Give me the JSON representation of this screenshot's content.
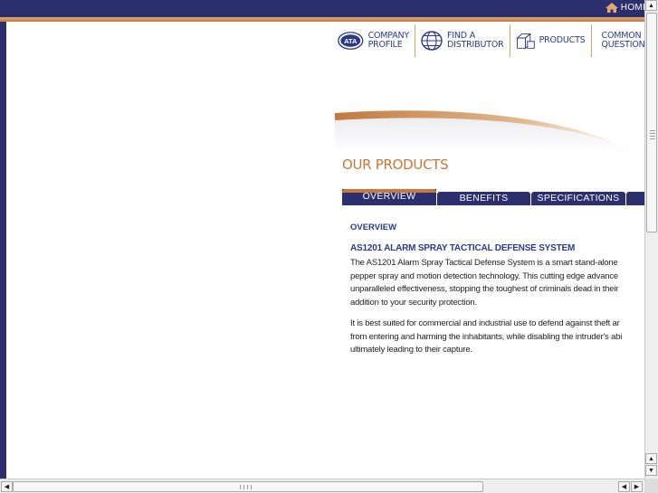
{
  "header": {
    "home_label": "HOME"
  },
  "nav": {
    "company_profile": [
      "COMPANY",
      "PROFILE"
    ],
    "find_distributor": [
      "FIND A",
      "DISTRIBUTOR"
    ],
    "products": "PRODUCTS",
    "questions": [
      "COMMON",
      "QUESTIONS"
    ]
  },
  "section_title": "OUR PRODUCTS",
  "tabs": [
    "OVERVIEW",
    "BENEFITS",
    "SPECIFICATIONS",
    ""
  ],
  "content": {
    "heading": "OVERVIEW",
    "product_title": "AS1201 ALARM SPRAY TACTICAL DEFENSE SYSTEM",
    "paragraph1": [
      "The AS1201 Alarm Spray Tactical Defense System is a smart stand-alone",
      "pepper spray and motion detection technology. This cutting edge advance",
      "unparalleled effectiveness, stopping the toughest of criminals dead in their",
      "addition to your security protection."
    ],
    "paragraph2": [
      "It is best suited for commercial and industrial use to defend against theft ar",
      "from entering and harming the inhabitants, while disabling the intruder's abi",
      "ultimately leading to their capture."
    ]
  },
  "colors": {
    "navy": "#2b2f6d",
    "accent_orange": "#c9773a",
    "link_blue": "#2b3a8a"
  }
}
